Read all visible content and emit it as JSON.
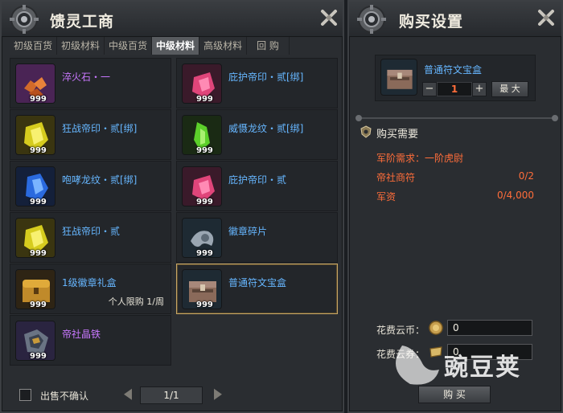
{
  "left_panel": {
    "title": "馈灵工商",
    "tabs": [
      "初级百货",
      "初级材料",
      "中级百货",
      "中级材料",
      "高级材料",
      "回 购"
    ],
    "active_tab_index": 3,
    "items": [
      {
        "name": "淬火石・一",
        "count": "999",
        "color": "purple",
        "icon": "ore-chunks-icon"
      },
      {
        "name": "庇护帝印・贰[绑]",
        "count": "999",
        "color": "blue",
        "icon": "pink-crystal-icon"
      },
      {
        "name": "狂战帝印・贰[绑]",
        "count": "999",
        "color": "blue",
        "icon": "yellow-crystal-icon"
      },
      {
        "name": "威慑龙纹・贰[绑]",
        "count": "999",
        "color": "blue",
        "icon": "green-crystal-icon"
      },
      {
        "name": "咆哮龙纹・贰[绑]",
        "count": "999",
        "color": "blue",
        "icon": "blue-crystal-icon"
      },
      {
        "name": "庇护帝印・贰",
        "count": "999",
        "color": "blue",
        "icon": "pink-crystal-icon"
      },
      {
        "name": "狂战帝印・贰",
        "count": "999",
        "color": "blue",
        "icon": "yellow-crystal-icon"
      },
      {
        "name": "徽章碎片",
        "count": "999",
        "color": "blue",
        "icon": "badge-fragment-icon"
      },
      {
        "name": "1级徽章礼盒",
        "count": "999",
        "color": "blue",
        "icon": "gold-chest-icon",
        "note": "个人限购 1/周"
      },
      {
        "name": "普通符文宝盒",
        "count": "999",
        "color": "blue",
        "icon": "rune-box-icon",
        "selected": true
      },
      {
        "name": "帝社晶铁",
        "count": "999",
        "color": "purple",
        "icon": "crystal-iron-icon"
      }
    ],
    "footer": {
      "no_confirm_label": "出售不确认",
      "page": "1/1",
      "prev_icon": "prev-page-icon",
      "next_icon": "next-page-icon"
    }
  },
  "right_panel": {
    "title": "购买设置",
    "target": {
      "name": "普通符文宝盒",
      "icon": "rune-box-icon",
      "minus": "−",
      "plus": "+",
      "quantity": "1",
      "max_label": "最 大"
    },
    "requirements": {
      "title": "购买需要",
      "rows": [
        {
          "label": "军阶需求：一阶虎尉",
          "value": ""
        },
        {
          "label": "帝社商符",
          "value": "0/2"
        },
        {
          "label": "军资",
          "value": "0/4,000"
        }
      ]
    },
    "costs": [
      {
        "label": "花费云币：",
        "value": "0",
        "icon": "coin-icon"
      },
      {
        "label": "花费云券：",
        "value": "0",
        "icon": "voucher-icon"
      }
    ],
    "buy_label": "购 买"
  },
  "watermark": {
    "text": "豌豆荚"
  },
  "colors": {
    "blue_name": "#66b6ff",
    "purple_name": "#c978ff",
    "warning": "#ff6d3a",
    "selected_border": "#c7a665"
  }
}
